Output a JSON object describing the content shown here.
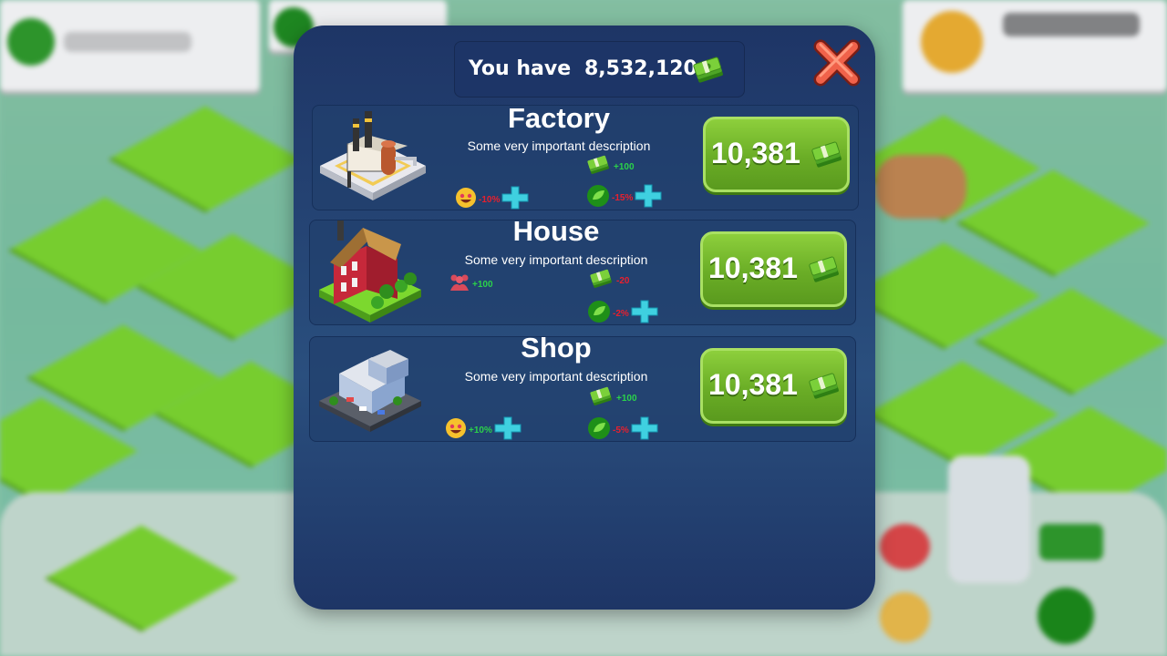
{
  "dialog": {
    "balance_label": "You have",
    "balance_value": "8,532,120",
    "close_icon": "close-x-icon"
  },
  "items": [
    {
      "name": "Factory",
      "description": "Some very important description",
      "price": "10,381",
      "stats": {
        "money": "+100",
        "happiness": "-10%",
        "ecology": "-15%"
      }
    },
    {
      "name": "House",
      "description": "Some very important description",
      "price": "10,381",
      "stats": {
        "population": "+100",
        "money": "-20",
        "ecology": "-2%"
      }
    },
    {
      "name": "Shop",
      "description": "Some very important description",
      "price": "10,381",
      "stats": {
        "money": "+100",
        "happiness": "+10%",
        "ecology": "-5%"
      }
    }
  ],
  "colors": {
    "panel": "#1e3566",
    "buy_button": "#6aad26",
    "positive": "#2bd24a",
    "negative": "#e8202e"
  }
}
